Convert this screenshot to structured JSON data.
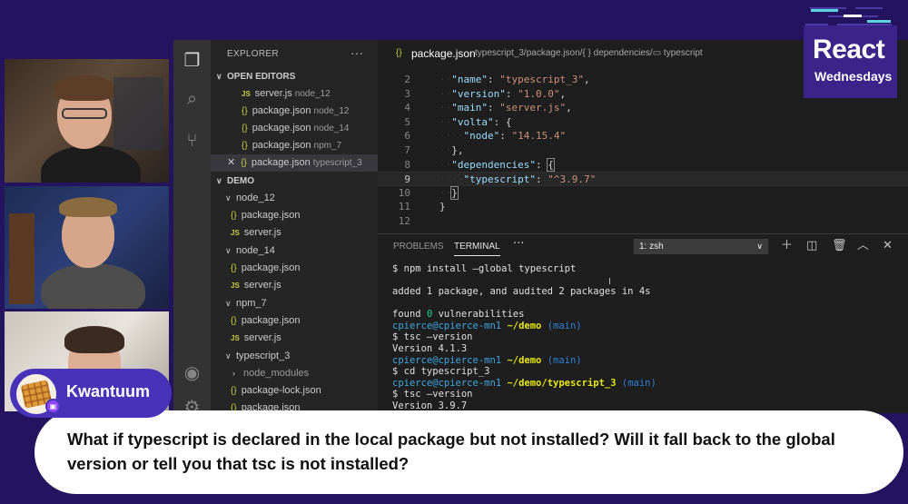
{
  "logo": {
    "line1": "React",
    "line2": "Wednesdays"
  },
  "explorer": {
    "title": "EXPLORER",
    "more": "···",
    "open_editors_label": "OPEN EDITORS",
    "open_editors": [
      {
        "icon": "JS",
        "name": "server.js",
        "desc": "node_12"
      },
      {
        "icon": "{}",
        "name": "package.json",
        "desc": "node_12"
      },
      {
        "icon": "{}",
        "name": "package.json",
        "desc": "node_14"
      },
      {
        "icon": "{}",
        "name": "package.json",
        "desc": "npm_7"
      },
      {
        "icon": "{}",
        "name": "package.json",
        "desc": "typescript_3"
      }
    ],
    "folder_label": "DEMO",
    "tree": [
      {
        "type": "folder",
        "name": "node_12"
      },
      {
        "type": "json",
        "name": "package.json"
      },
      {
        "type": "js",
        "name": "server.js"
      },
      {
        "type": "folder",
        "name": "node_14"
      },
      {
        "type": "json",
        "name": "package.json"
      },
      {
        "type": "js",
        "name": "server.js"
      },
      {
        "type": "folder",
        "name": "npm_7"
      },
      {
        "type": "json",
        "name": "package.json"
      },
      {
        "type": "js",
        "name": "server.js"
      },
      {
        "type": "folder",
        "name": "typescript_3"
      },
      {
        "type": "folder-collapsed",
        "name": "node_modules"
      },
      {
        "type": "json",
        "name": "package-lock.json"
      },
      {
        "type": "json",
        "name": "package.json"
      }
    ]
  },
  "editor": {
    "tab_icon": "{}",
    "tab_name": "package.json",
    "breadcrumb": "typescript_3/package.json/{ } dependencies/▭ typescript",
    "lines": [
      {
        "n": "2",
        "key": "\"name\"",
        "sep": ": ",
        "val": "\"typescript_3\"",
        "end": ","
      },
      {
        "n": "3",
        "key": "\"version\"",
        "sep": ": ",
        "val": "\"1.0.0\"",
        "end": ","
      },
      {
        "n": "4",
        "key": "\"main\"",
        "sep": ": ",
        "val": "\"server.js\"",
        "end": ","
      },
      {
        "n": "5",
        "key": "\"volta\"",
        "sep": ": ",
        "val": "",
        "end": "{"
      },
      {
        "n": "6",
        "key": "\"node\"",
        "sep": ": ",
        "val": "\"14.15.4\"",
        "end": ""
      },
      {
        "n": "7",
        "key": "",
        "sep": "",
        "val": "",
        "end": "},"
      },
      {
        "n": "8",
        "key": "\"dependencies\"",
        "sep": ": ",
        "val": "",
        "end": "{"
      },
      {
        "n": "9",
        "key": "\"typescript\"",
        "sep": ": ",
        "val": "\"^3.9.7\"",
        "end": ""
      },
      {
        "n": "10",
        "key": "",
        "sep": "",
        "val": "",
        "end": "}"
      },
      {
        "n": "11",
        "key": "",
        "sep": "",
        "val": "",
        "end": "}"
      },
      {
        "n": "12",
        "key": "",
        "sep": "",
        "val": "",
        "end": ""
      }
    ]
  },
  "panel": {
    "tabs": [
      "PROBLEMS",
      "TERMINAL"
    ],
    "more": "···",
    "terminal_select": "1: zsh",
    "terminal_lines": [
      {
        "kind": "cmd",
        "text": "$ npm install —global typescript"
      },
      {
        "kind": "blank",
        "text": ""
      },
      {
        "kind": "out",
        "text": "added 1 package, and audited 2 packages in 4s"
      },
      {
        "kind": "blank",
        "text": ""
      },
      {
        "kind": "vuln",
        "pre": "found ",
        "num": "0",
        "post": " vulnerabilities"
      },
      {
        "kind": "prompt",
        "user": "cpierce@cpierce-mn1",
        "dir": "~/demo",
        "branch": "(main)"
      },
      {
        "kind": "cmd",
        "text": "$ tsc —version"
      },
      {
        "kind": "out",
        "text": "Version 4.1.3"
      },
      {
        "kind": "prompt",
        "user": "cpierce@cpierce-mn1",
        "dir": "~/demo",
        "branch": "(main)"
      },
      {
        "kind": "cmd",
        "text": "$ cd typescript_3"
      },
      {
        "kind": "prompt",
        "user": "cpierce@cpierce-mn1",
        "dir": "~/demo/typescript_3",
        "branch": "(main)"
      },
      {
        "kind": "cmd",
        "text": "$ tsc —version"
      },
      {
        "kind": "out",
        "text": "Version 3.9.7"
      }
    ]
  },
  "chat": {
    "username": "Kwantuum",
    "message": "What if typescript is declared in the local package but not installed? Will it fall back to the global version or tell you that tsc is not installed?"
  },
  "colors": {
    "brand_purple": "#24135e",
    "pill_purple": "#4833b8",
    "terminal_yellow": "#e5e510"
  }
}
